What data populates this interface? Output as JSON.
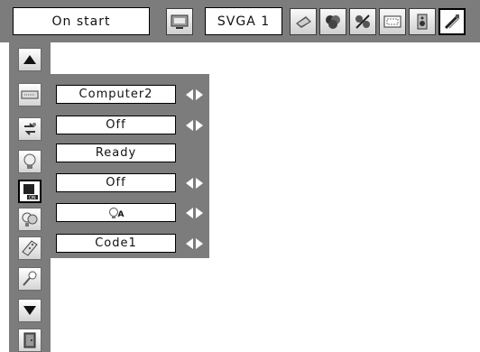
{
  "top_bar": {
    "menu_label": "On start",
    "signal_label": "SVGA 1",
    "icons": [
      {
        "name": "computer-input-icon",
        "selected": false
      },
      {
        "name": "pc-adjust-icon",
        "selected": false
      },
      {
        "name": "image-select-icon",
        "selected": false
      },
      {
        "name": "image-adjust-icon",
        "selected": false
      },
      {
        "name": "screen-icon",
        "selected": false
      },
      {
        "name": "sound-icon",
        "selected": false
      },
      {
        "name": "setting-icon",
        "selected": true
      }
    ]
  },
  "sidebar": {
    "items": [
      {
        "name": "scroll-up-icon",
        "selected": false
      },
      {
        "name": "input-terminal-icon",
        "selected": false
      },
      {
        "name": "input-search-icon",
        "selected": false
      },
      {
        "name": "standby-lamp-icon",
        "selected": false
      },
      {
        "name": "power-on-icon",
        "selected": true
      },
      {
        "name": "lamp-mode-icon",
        "selected": false
      },
      {
        "name": "remote-code-icon",
        "selected": false
      },
      {
        "name": "security-key-icon",
        "selected": false
      },
      {
        "name": "scroll-down-icon",
        "selected": false
      },
      {
        "name": "exit-door-icon",
        "selected": false
      }
    ]
  },
  "settings": {
    "rows": [
      {
        "name": "terminal-setting",
        "value": "Computer2",
        "has_arrows": true
      },
      {
        "name": "input-search-setting",
        "value": "Off",
        "has_arrows": true
      },
      {
        "name": "standby-status",
        "value": "Ready",
        "has_arrows": false
      },
      {
        "name": "direct-on-setting",
        "value": "Off",
        "has_arrows": true
      },
      {
        "name": "lamp-control-setting",
        "value": "",
        "icon": "lamp-auto-icon",
        "icon_text": "A",
        "has_arrows": true
      },
      {
        "name": "remote-control-setting",
        "value": "Code1",
        "has_arrows": true
      }
    ]
  },
  "colors": {
    "panel_gray": "#7c7c7c",
    "field_white": "#ffffff",
    "arrow_white": "#ffffff"
  }
}
